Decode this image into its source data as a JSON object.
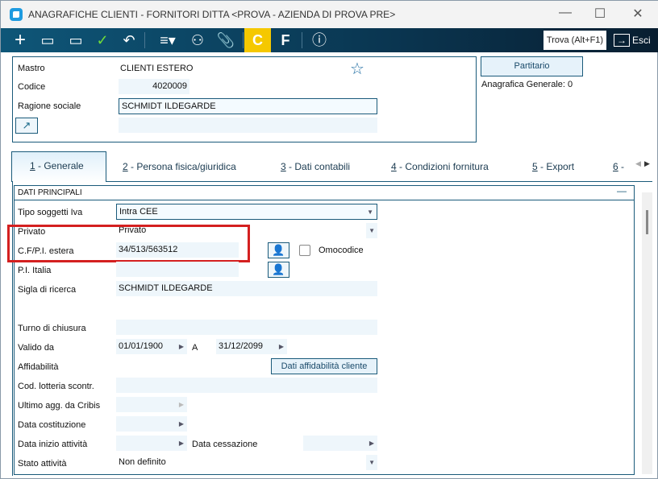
{
  "window": {
    "title": "ANAGRAFICHE CLIENTI - FORNITORI DITTA <PROVA - AZIENDA DI PROVA PRE>",
    "minimize": "—",
    "maximize": "☐",
    "close": "✕"
  },
  "toolbar": {
    "find_label": "Trova (Alt+F1)",
    "exit_label": "Esci",
    "c_label": "C",
    "f_label": "F"
  },
  "header": {
    "mastro_label": "Mastro",
    "mastro_value": "CLIENTI ESTERO",
    "codice_label": "Codice",
    "codice_value": "4020009",
    "ragione_label": "Ragione sociale",
    "ragione_value": "SCHMIDT ILDEGARDE",
    "partitario_label": "Partitario",
    "anagrafica_generale": "Anagrafica Generale:  0"
  },
  "tabs": [
    {
      "num": "1",
      "label": " - Generale"
    },
    {
      "num": "2",
      "label": " - Persona fisica/giuridica"
    },
    {
      "num": "3",
      "label": " - Dati contabili"
    },
    {
      "num": "4",
      "label": " - Condizioni fornitura"
    },
    {
      "num": "5",
      "label": " - Export"
    },
    {
      "num": "6",
      "label": " -"
    }
  ],
  "section": {
    "title": "DATI PRINCIPALI",
    "collapse": "—"
  },
  "form": {
    "tipo_label": "Tipo soggetti Iva",
    "tipo_value": "Intra CEE",
    "privato_label": "Privato",
    "privato_value": "Privato",
    "cf_label": "C.F/P.I. estera",
    "cf_value": "34/513/563512",
    "omocodice_label": "Omocodice",
    "pi_label": "P.I. Italia",
    "pi_value": "",
    "sigla_label": "Sigla di ricerca",
    "sigla_value": "SCHMIDT ILDEGARDE",
    "turno_label": "Turno di chiusura",
    "valido_label": "Valido da",
    "valido_from": "01/01/1900",
    "a_label": "A",
    "valido_to": "31/12/2099",
    "affid_label": "Affidabilità",
    "affid_button": "Dati affidabilità cliente",
    "lotteria_label": "Cod. lotteria scontr.",
    "cribis_label": "Ultimo agg. da Cribis",
    "costituzione_label": "Data costituzione",
    "inizio_label": "Data inizio attività",
    "cessazione_label": "Data cessazione",
    "stato_label": "Stato attività",
    "stato_value": "Non definito"
  },
  "colors": {
    "toolbar": "#0a3550",
    "accent": "#1a5a7a",
    "highlight": "#d42020",
    "c_button": "#f5c800"
  }
}
